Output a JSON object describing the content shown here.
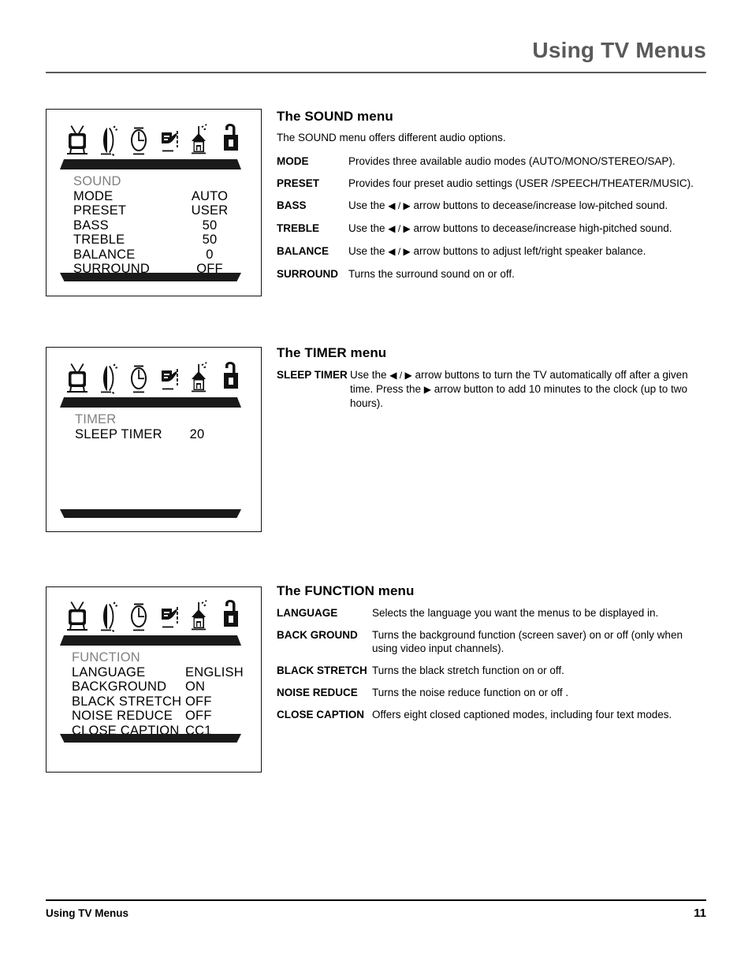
{
  "header": {
    "title": "Using TV Menus"
  },
  "footer": {
    "label": "Using TV Menus",
    "page_number": "11"
  },
  "osd_icons": [
    {
      "name": "tv-icon",
      "label": "TV",
      "selected": false
    },
    {
      "name": "sound-icon",
      "label": "SOUND",
      "selected": false
    },
    {
      "name": "timer-clock-icon",
      "label": "TIMER",
      "selected": false
    },
    {
      "name": "function-hand-icon",
      "label": "FUNCTION",
      "selected": false
    },
    {
      "name": "channel-antenna-icon",
      "label": "CHANNEL",
      "selected": false
    },
    {
      "name": "lock-icon",
      "label": "PARENTAL LOCK",
      "selected": true
    }
  ],
  "sound_screen": {
    "title": "SOUND",
    "rows": [
      {
        "key": "MODE",
        "value": "AUTO"
      },
      {
        "key": "PRESET",
        "value": "USER"
      },
      {
        "key": "BASS",
        "value": "50"
      },
      {
        "key": "TREBLE",
        "value": "50"
      },
      {
        "key": "BALANCE",
        "value": "0"
      },
      {
        "key": "SURROUND",
        "value": "OFF"
      }
    ]
  },
  "timer_screen": {
    "title": "TIMER",
    "rows": [
      {
        "key": "SLEEP TIMER",
        "value": "20"
      }
    ]
  },
  "function_screen": {
    "title": "FUNCTION",
    "rows": [
      {
        "key": "LANGUAGE",
        "value": "ENGLISH"
      },
      {
        "key": "BACKGROUND",
        "value": "ON"
      },
      {
        "key": "BLACK STRETCH",
        "value": "OFF"
      },
      {
        "key": "NOISE REDUCE",
        "value": "OFF"
      },
      {
        "key": "CLOSE CAPTION",
        "value": "CC1"
      }
    ]
  },
  "sound_section": {
    "heading": "The SOUND menu",
    "intro": "The SOUND menu offers different audio options.",
    "items": [
      {
        "term": "MODE",
        "desc": "Provides three available audio modes (AUTO/MONO/STEREO/SAP)."
      },
      {
        "term": "PRESET",
        "desc": "Provides four preset audio settings (USER /SPEECH/THEATER/MUSIC)."
      },
      {
        "term": "BASS",
        "desc_before": "Use the ",
        "arrows": "◀ / ▶",
        "desc_after": " arrow buttons to decease/increase low-pitched sound."
      },
      {
        "term": "TREBLE",
        "desc_before": "Use the ",
        "arrows": "◀ / ▶",
        "desc_after": " arrow buttons to decease/increase high-pitched sound."
      },
      {
        "term": "BALANCE",
        "desc_before": "Use the ",
        "arrows": "◀ / ▶",
        "desc_after": " arrow buttons to adjust left/right speaker balance."
      },
      {
        "term": "SURROUND",
        "desc": "Turns the surround sound on or off."
      }
    ]
  },
  "timer_section": {
    "heading": "The TIMER menu",
    "items": [
      {
        "term": "SLEEP TIMER",
        "desc_before": "Use the ",
        "arrows": "◀ / ▶",
        "desc_mid": " arrow buttons to turn the TV automatically off after a given time. Press the ",
        "arrow2": "▶",
        "desc_after": " arrow button to add 10 minutes to the clock (up to two hours)."
      }
    ]
  },
  "function_section": {
    "heading": "The FUNCTION menu",
    "items": [
      {
        "term": "LANGUAGE",
        "desc": "Selects the language you want the menus to be displayed in."
      },
      {
        "term": "BACK GROUND",
        "desc": "Turns the background function (screen saver) on or off (only when using video input channels)."
      },
      {
        "term": "BLACK STRETCH",
        "desc": "Turns the black stretch function on or off."
      },
      {
        "term": "NOISE REDUCE",
        "desc": "Turns the noise reduce function on or off ."
      },
      {
        "term": "CLOSE CAPTION",
        "desc": "Offers eight closed captioned modes, including four text modes."
      }
    ]
  },
  "colors": {
    "header_gray": "#5a5a5a",
    "osd_title_gray": "#808080",
    "osd_bar_black": "#1a1a1a",
    "text_black": "#000000"
  }
}
